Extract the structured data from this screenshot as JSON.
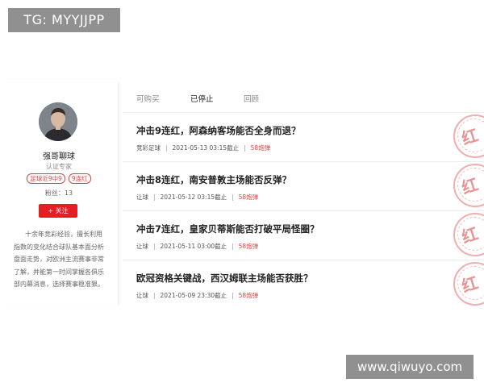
{
  "watermarks": {
    "top_left": "TG: MYYJJPP",
    "bottom_right": "www.qiwuyo.com"
  },
  "profile": {
    "name": "强哥聊球",
    "role": "认证专家",
    "tags": [
      "足球近9中9",
      "9连红"
    ],
    "fans": "粉丝：13",
    "follow_label": "+ 关注",
    "bio": "十余年竞彩经验，擅长利用指数的变化结合球队基本面分析盘面走势，对欧洲主流赛事非常了解，并能第一时间掌握各俱乐部内幕消息，选择赛事稳准狠。"
  },
  "tabs": [
    {
      "label": "可购买",
      "active": false
    },
    {
      "label": "已停止",
      "active": true
    },
    {
      "label": "回顾",
      "active": false
    }
  ],
  "articles": [
    {
      "title": "冲击9连红，阿森纳客场能否全身而退？",
      "category": "竞彩足球",
      "time": "2021-05-13 03:15截止",
      "cost": "58炮弹",
      "stamp": "红"
    },
    {
      "title": "冲击8连红，南安普敦主场能否反弹？",
      "category": "让球",
      "time": "2021-05-12 03:15截止",
      "cost": "58炮弹",
      "stamp": "红"
    },
    {
      "title": "冲击7连红，皇家贝蒂斯能否打破平局怪圈？",
      "category": "让球",
      "time": "2021-05-11 03:00截止",
      "cost": "58炮弹",
      "stamp": "红"
    },
    {
      "title": "欧冠资格关键战，西汉姆联主场能否获胜？",
      "category": "让球",
      "time": "2021-05-09 23:30截止",
      "cost": "58炮弹",
      "stamp": "红"
    }
  ],
  "colors": {
    "accent": "#e31e24",
    "tag": "#e0423f",
    "stamp": "#e06e6e"
  },
  "icons": {
    "separator": "|"
  }
}
